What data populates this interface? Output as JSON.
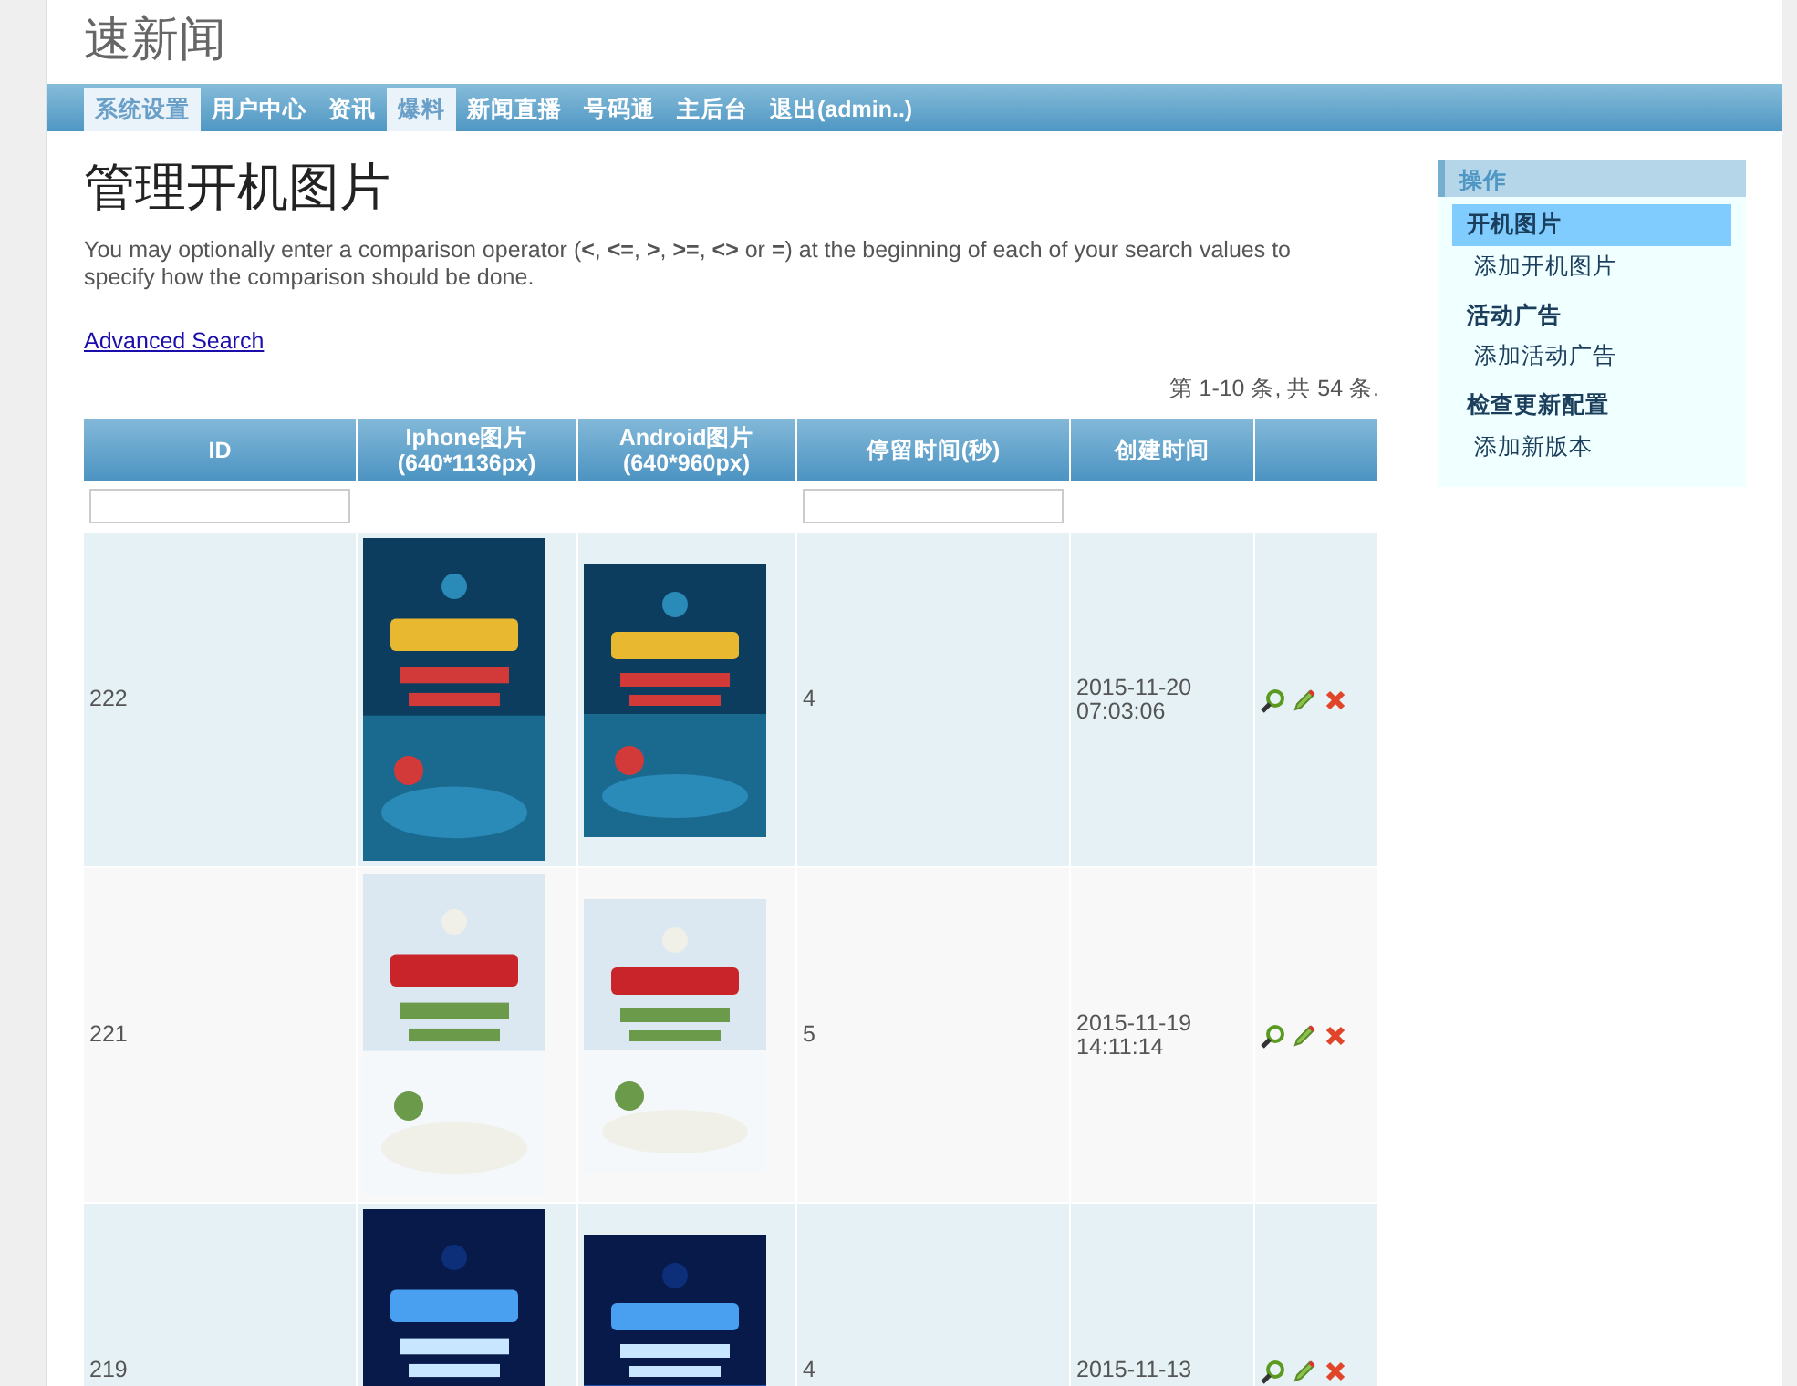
{
  "site_title": "速新闻",
  "nav": [
    {
      "label": "系统设置",
      "selected": true
    },
    {
      "label": "用户中心",
      "selected": false
    },
    {
      "label": "资讯",
      "selected": false
    },
    {
      "label": "爆料",
      "selected": true
    },
    {
      "label": "新闻直播",
      "selected": false
    },
    {
      "label": "号码通",
      "selected": false
    },
    {
      "label": "主后台",
      "selected": false
    },
    {
      "label": "退出(admin..)",
      "selected": false
    }
  ],
  "page_title": "管理开机图片",
  "hint": "You may optionally enter a comparison operator (**<**, **<=**, **>**, **>=**, **<>** or **=**) at the beginning of each of your search values to specify how the comparison should be done.",
  "advanced_search": "Advanced Search",
  "summary": "第 1-10 条, 共 54 条.",
  "table": {
    "columns": [
      {
        "label": "ID",
        "filter": true
      },
      {
        "label": "Iphone图片\n(640*1136px)",
        "filter": false
      },
      {
        "label": "Android图片\n(640*960px)",
        "filter": false
      },
      {
        "label": "停留时间(秒)",
        "filter": true
      },
      {
        "label": "创建时间",
        "filter": false
      },
      {
        "filter": false
      }
    ],
    "rows": [
      {
        "id": "222",
        "dwell": "4",
        "created": "2015-11-20\n07:03:06"
      },
      {
        "id": "221",
        "dwell": "5",
        "created": "2015-11-19\n14:11:14"
      },
      {
        "id": "219",
        "dwell": "4",
        "created": "2015-11-13"
      }
    ]
  },
  "sidebar": {
    "title": "操作",
    "items": [
      {
        "kind": "header",
        "label": "开机图片",
        "selected": true
      },
      {
        "kind": "link",
        "label": "添加开机图片",
        "selected": false
      },
      {
        "kind": "header",
        "label": "活动广告",
        "selected": false
      },
      {
        "kind": "link",
        "label": "添加活动广告",
        "selected": false
      },
      {
        "kind": "header",
        "label": "检查更新配置",
        "selected": false
      },
      {
        "kind": "link",
        "label": "添加新版本",
        "selected": false
      }
    ]
  }
}
